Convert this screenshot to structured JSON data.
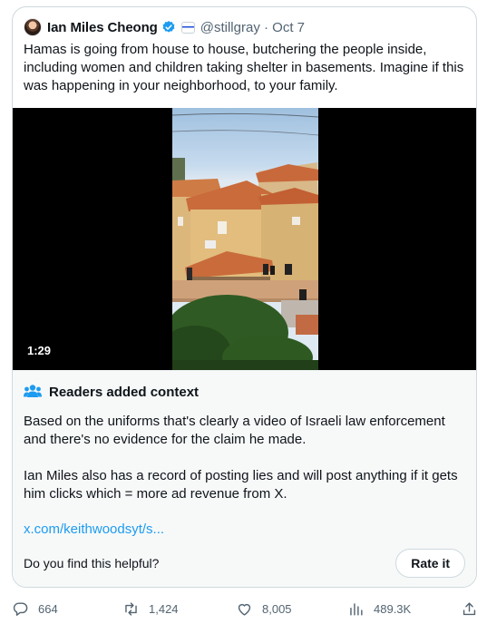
{
  "tweet": {
    "author_name": "Ian Miles Cheong",
    "handle_line": "@stillgray · Oct 7",
    "text": "Hamas is going from house to house, butchering the people inside, including women and children taking shelter in basements. Imagine if this was happening in your neighborhood, to your family.",
    "video_duration": "1:29"
  },
  "community_note": {
    "title": "Readers added context",
    "paragraphs": [
      "Based on the uniforms that's clearly a video of Israeli law enforcement and there's no evidence for the claim he made.",
      "Ian Miles also has a record of posting lies and will post anything if it gets him clicks which = more ad revenue from X."
    ],
    "link": "x.com/keithwoodsyt/s...",
    "helpful_prompt": "Do you find this helpful?",
    "rate_label": "Rate it"
  },
  "actions": {
    "replies": "664",
    "reposts": "1,424",
    "likes": "8,005",
    "views": "489.3K"
  },
  "icons": {
    "verified": "verified-badge-icon",
    "affiliation": "affiliation-badge-icon",
    "notes": "community-notes-people-icon",
    "reply": "reply-icon",
    "repost": "repost-icon",
    "like": "heart-icon",
    "views": "analytics-icon",
    "share": "share-icon"
  },
  "colors": {
    "accent": "#1d9bf0",
    "muted_text": "#536471",
    "border": "#cfd9de",
    "note_background": "#f7f9f9"
  }
}
